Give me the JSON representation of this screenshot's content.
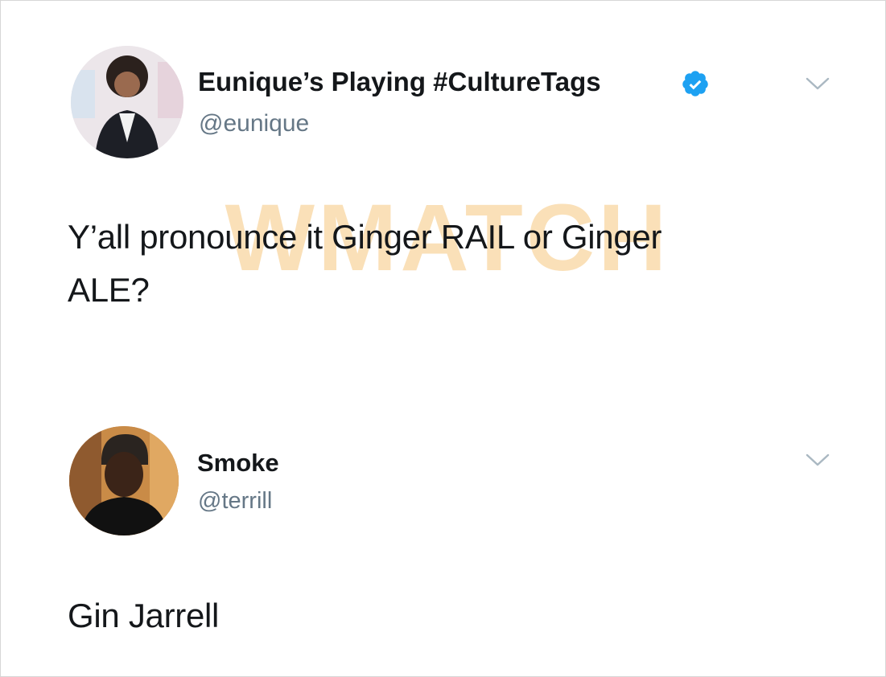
{
  "tweets": [
    {
      "display_name": "Eunique’s Playing #CultureTags",
      "verified": true,
      "verified_icon": "verified-badge-icon",
      "handle": "@eunique",
      "text": "Y’all pronounce it Ginger RAIL or Ginger ALE?",
      "menu_icon": "chevron-down-icon"
    },
    {
      "display_name": "Smoke",
      "verified": false,
      "handle": "@terrill",
      "text": "Gin Jarrell",
      "menu_icon": "chevron-down-icon"
    }
  ],
  "watermark": {
    "text": "WMATCH"
  },
  "colors": {
    "name": "#14171a",
    "handle": "#657786",
    "verified": "#1da1f2",
    "chevron": "#aab8c2",
    "watermark": "#f5c77e"
  }
}
